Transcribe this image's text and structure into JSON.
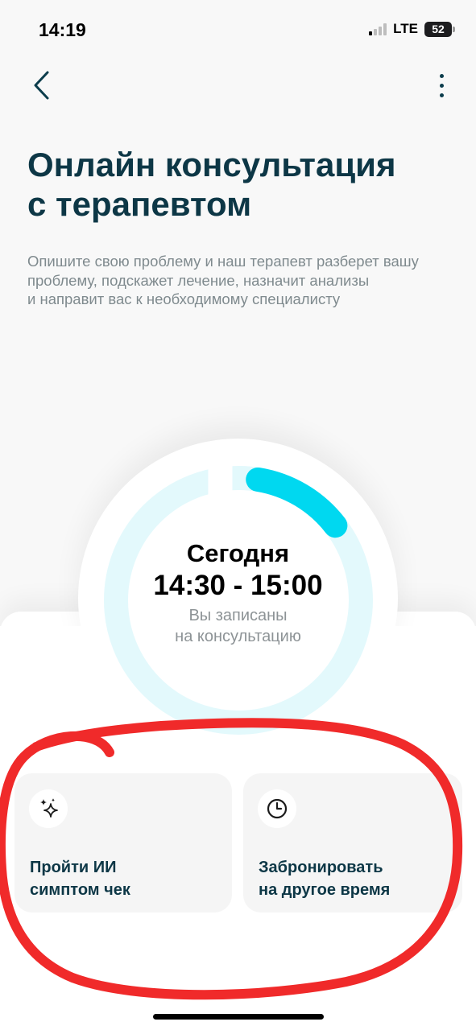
{
  "status_bar": {
    "time": "14:19",
    "network": "LTE",
    "battery_level": "52",
    "signal_bars_active": 1
  },
  "nav": {
    "back_icon": "chevron-left-icon",
    "menu_icon": "more-vertical-icon"
  },
  "header": {
    "title": "Онлайн консультация\nс терапевтом",
    "description": "Опишите свою проблему и наш терапевт разберет вашу\nпроблему, подскажет лечение, назначит анализы\nи направит вас к необходимому специалисту"
  },
  "appointment": {
    "day": "Сегодня",
    "time": "14:30 - 15:00",
    "note": "Вы записаны\nна консультацию",
    "progress_fraction": 0.12
  },
  "actions": [
    {
      "label": "Пройти ИИ\nсимптом чек",
      "icon": "sparkles-icon"
    },
    {
      "label": "Забронировать\nна другое время",
      "icon": "clock-icon"
    }
  ],
  "colors": {
    "title": "#0d3746",
    "ring_track": "#e3f9fc",
    "ring_progress": "#00d8f0",
    "annotation": "#f02a2a"
  }
}
